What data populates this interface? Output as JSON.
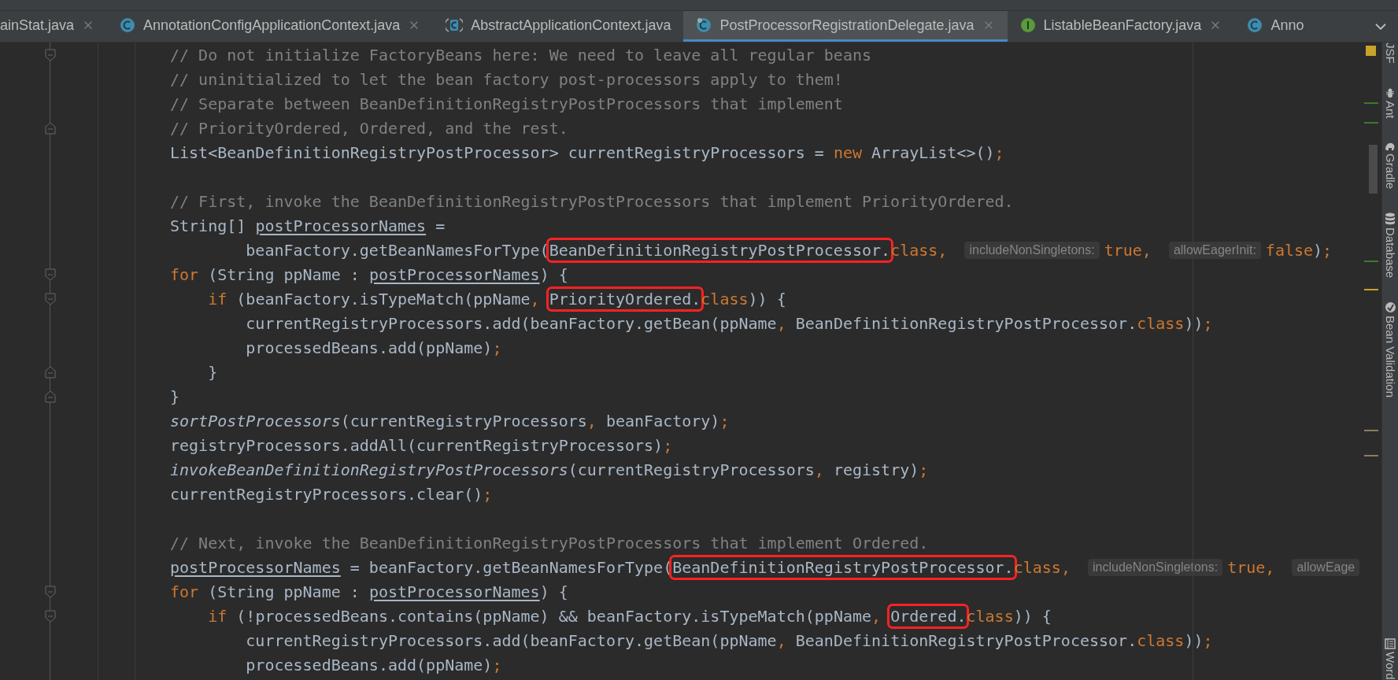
{
  "tabs": [
    {
      "label": "ainStat.java",
      "selected": false,
      "close": true
    },
    {
      "label": "AnnotationConfigApplicationContext.java",
      "kind": "class",
      "selected": false,
      "close": true
    },
    {
      "label": "AbstractApplicationContext.java",
      "kind": "abstract-class",
      "selected": false,
      "close": false
    },
    {
      "label": "PostProcessorRegistrationDelegate.java",
      "kind": "class-badged",
      "selected": true,
      "close": true
    },
    {
      "label": "ListableBeanFactory.java",
      "kind": "interface",
      "selected": false,
      "close": true
    },
    {
      "label": "Anno",
      "kind": "class",
      "selected": false,
      "close": false
    }
  ],
  "code_lines": [
    {
      "kind": "fold-start",
      "tokens": [
        {
          "kind": "comment",
          "text": "// Do not initialize FactoryBeans here: We need to leave all regular beans"
        }
      ]
    },
    {
      "kind": "code",
      "tokens": [
        {
          "kind": "comment",
          "text": "// uninitialized to let the bean factory post-processors apply to them!"
        }
      ]
    },
    {
      "kind": "code",
      "tokens": [
        {
          "kind": "comment",
          "text": "// Separate between BeanDefinitionRegistryPostProcessors that implement"
        }
      ]
    },
    {
      "kind": "fold-end",
      "tokens": [
        {
          "kind": "comment",
          "text": "// PriorityOrdered, Ordered, and the rest."
        }
      ]
    },
    {
      "kind": "code",
      "tokens": [
        {
          "kind": "plain",
          "text": "List<BeanDefinitionRegistryPostProcessor> currentRegistryProcessors = "
        },
        {
          "kind": "keyword",
          "text": "new"
        },
        {
          "kind": "plain",
          "text": " ArrayList<>()"
        },
        {
          "kind": "keyword",
          "text": ";"
        }
      ]
    },
    {
      "kind": "blank"
    },
    {
      "kind": "code",
      "tokens": [
        {
          "kind": "comment",
          "text": "// First, invoke the BeanDefinitionRegistryPostProcessors that implement PriorityOrdered."
        }
      ]
    },
    {
      "kind": "code",
      "tokens": [
        {
          "kind": "plain",
          "text": "String[] "
        },
        {
          "kind": "field-ref",
          "text": "postProcessorNames"
        },
        {
          "kind": "plain",
          "text": " ="
        }
      ]
    },
    {
      "kind": "code",
      "tokens": [
        {
          "kind": "plain",
          "text": "        beanFactory.getBeanNamesForType("
        },
        {
          "kind": "boxed",
          "text": "BeanDefinitionRegistryPostProcessor."
        },
        {
          "kind": "keyword",
          "text": "class, "
        },
        {
          "kind": "hint",
          "text": "includeNonSingletons:"
        },
        {
          "kind": "keyword",
          "text": "true, "
        },
        {
          "kind": "hint",
          "text": "allowEagerInit:"
        },
        {
          "kind": "keyword",
          "text": "false"
        },
        {
          "kind": "plain",
          "text": ")"
        },
        {
          "kind": "keyword",
          "text": ";"
        }
      ]
    },
    {
      "kind": "fold-start",
      "tokens": [
        {
          "kind": "keyword",
          "text": "for"
        },
        {
          "kind": "plain",
          "text": " (String ppName : "
        },
        {
          "kind": "field-ref",
          "text": "postProcessorNames"
        },
        {
          "kind": "plain",
          "text": ") {"
        }
      ]
    },
    {
      "kind": "fold-start",
      "tokens": [
        {
          "kind": "keyword",
          "text": "    if"
        },
        {
          "kind": "plain",
          "text": " (beanFactory.isTypeMatch(ppName"
        },
        {
          "kind": "keyword",
          "text": ", "
        },
        {
          "kind": "boxed",
          "text": "PriorityOrdered."
        },
        {
          "kind": "keyword",
          "text": "class"
        },
        {
          "kind": "plain",
          "text": ")) {"
        }
      ]
    },
    {
      "kind": "code",
      "tokens": [
        {
          "kind": "plain",
          "text": "        currentRegistryProcessors.add(beanFactory.getBean(ppName"
        },
        {
          "kind": "keyword",
          "text": ", "
        },
        {
          "kind": "plain",
          "text": "BeanDefinitionRegistryPostProcessor."
        },
        {
          "kind": "keyword",
          "text": "class"
        },
        {
          "kind": "plain",
          "text": "))"
        },
        {
          "kind": "keyword",
          "text": ";"
        }
      ]
    },
    {
      "kind": "code",
      "tokens": [
        {
          "kind": "plain",
          "text": "        processedBeans.add(ppName)"
        },
        {
          "kind": "keyword",
          "text": ";"
        }
      ]
    },
    {
      "kind": "fold-end",
      "tokens": [
        {
          "kind": "plain",
          "text": "    }"
        }
      ]
    },
    {
      "kind": "fold-end",
      "tokens": [
        {
          "kind": "plain",
          "text": "}"
        }
      ]
    },
    {
      "kind": "code",
      "tokens": [
        {
          "kind": "static-call",
          "text": "sortPostProcessors"
        },
        {
          "kind": "plain",
          "text": "(currentRegistryProcessors"
        },
        {
          "kind": "keyword",
          "text": ", "
        },
        {
          "kind": "plain",
          "text": "beanFactory)"
        },
        {
          "kind": "keyword",
          "text": ";"
        }
      ]
    },
    {
      "kind": "code",
      "tokens": [
        {
          "kind": "plain",
          "text": "registryProcessors.addAll(currentRegistryProcessors)"
        },
        {
          "kind": "keyword",
          "text": ";"
        }
      ]
    },
    {
      "kind": "code",
      "tokens": [
        {
          "kind": "static-call",
          "text": "invokeBeanDefinitionRegistryPostProcessors"
        },
        {
          "kind": "plain",
          "text": "(currentRegistryProcessors"
        },
        {
          "kind": "keyword",
          "text": ", "
        },
        {
          "kind": "plain",
          "text": "registry)"
        },
        {
          "kind": "keyword",
          "text": ";"
        }
      ]
    },
    {
      "kind": "code",
      "tokens": [
        {
          "kind": "plain",
          "text": "currentRegistryProcessors.clear()"
        },
        {
          "kind": "keyword",
          "text": ";"
        }
      ]
    },
    {
      "kind": "blank"
    },
    {
      "kind": "code",
      "tokens": [
        {
          "kind": "comment",
          "text": "// Next, invoke the BeanDefinitionRegistryPostProcessors that implement Ordered."
        }
      ]
    },
    {
      "kind": "code",
      "tokens": [
        {
          "kind": "field-ref",
          "text": "postProcessorNames"
        },
        {
          "kind": "plain",
          "text": " = beanFactory.getBeanNamesForType("
        },
        {
          "kind": "boxed",
          "text": "BeanDefinitionRegistryPostProcessor."
        },
        {
          "kind": "keyword",
          "text": "class, "
        },
        {
          "kind": "hint",
          "text": "includeNonSingletons:"
        },
        {
          "kind": "keyword",
          "text": "true, "
        },
        {
          "kind": "hint",
          "text": "allowEage"
        }
      ]
    },
    {
      "kind": "fold-start",
      "tokens": [
        {
          "kind": "keyword",
          "text": "for"
        },
        {
          "kind": "plain",
          "text": " (String ppName : "
        },
        {
          "kind": "field-ref",
          "text": "postProcessorNames"
        },
        {
          "kind": "plain",
          "text": ") {"
        }
      ]
    },
    {
      "kind": "fold-start",
      "tokens": [
        {
          "kind": "keyword",
          "text": "    if"
        },
        {
          "kind": "plain",
          "text": " (!processedBeans.contains(ppName) && beanFactory.isTypeMatch(ppName"
        },
        {
          "kind": "keyword",
          "text": ", "
        },
        {
          "kind": "boxed",
          "text": "Ordered."
        },
        {
          "kind": "keyword",
          "text": "class"
        },
        {
          "kind": "plain",
          "text": ")) {"
        }
      ]
    },
    {
      "kind": "code",
      "tokens": [
        {
          "kind": "plain",
          "text": "        currentRegistryProcessors.add(beanFactory.getBean(ppName"
        },
        {
          "kind": "keyword",
          "text": ", "
        },
        {
          "kind": "plain",
          "text": "BeanDefinitionRegistryPostProcessor."
        },
        {
          "kind": "keyword",
          "text": "class"
        },
        {
          "kind": "plain",
          "text": "))"
        },
        {
          "kind": "keyword",
          "text": ";"
        }
      ]
    },
    {
      "kind": "code",
      "tokens": [
        {
          "kind": "plain",
          "text": "        processedBeans.add(ppName)"
        },
        {
          "kind": "keyword",
          "text": ";"
        }
      ]
    }
  ],
  "tool_windows": [
    {
      "label": "JSF"
    },
    {
      "label": "Ant"
    },
    {
      "label": "Gradle"
    },
    {
      "label": "Database"
    },
    {
      "label": "Bean Validation"
    },
    {
      "label": "Word"
    }
  ]
}
